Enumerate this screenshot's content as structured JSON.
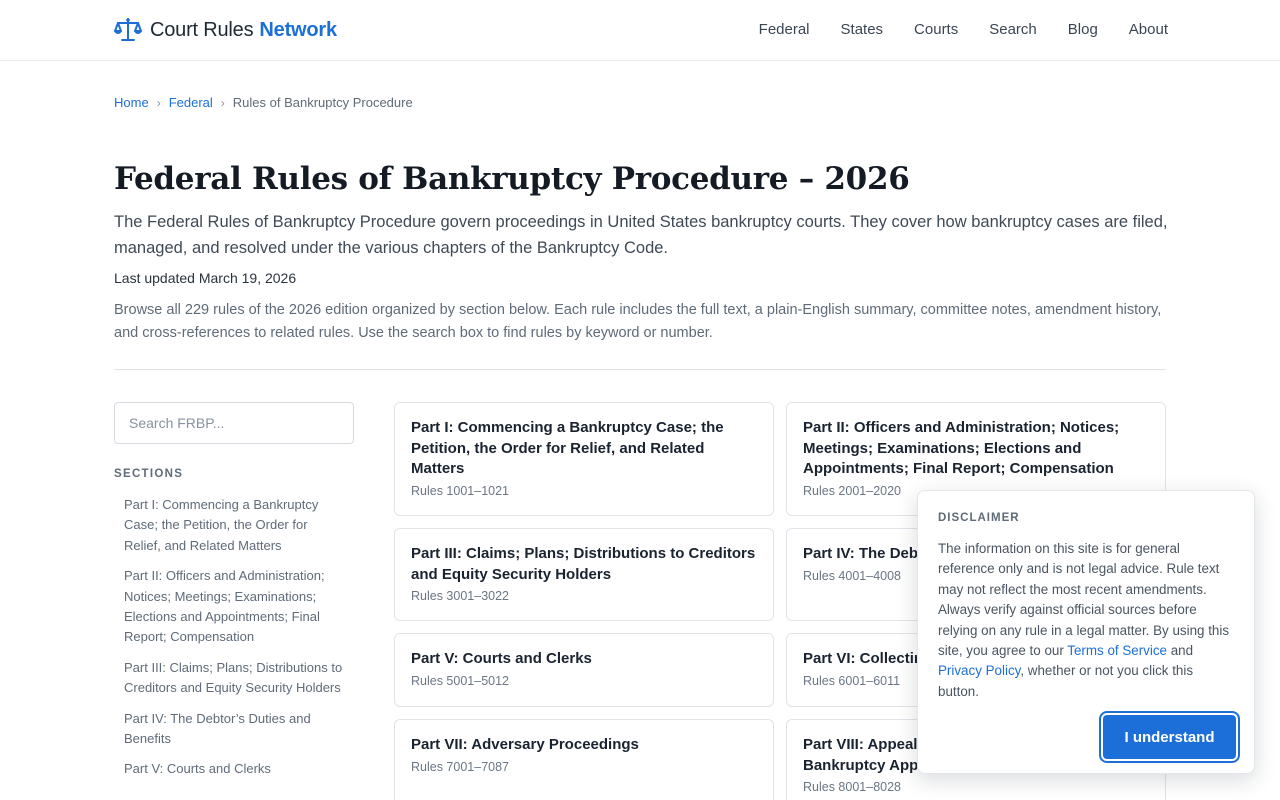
{
  "header": {
    "brand_name": "Court Rules",
    "brand_accent": "Network",
    "brand_icon": "scales-of-justice-icon",
    "nav": [
      "Federal",
      "States",
      "Courts",
      "Search",
      "Blog",
      "About"
    ]
  },
  "breadcrumb": {
    "home": "Home",
    "federal": "Federal",
    "current": "Rules of Bankruptcy Procedure",
    "separator": "›"
  },
  "page": {
    "title": "Federal Rules of Bankruptcy Procedure – 2026",
    "lede": "The Federal Rules of Bankruptcy Procedure govern proceedings in United States bankruptcy courts. They cover how bankruptcy cases are filed, managed, and resolved under the various chapters of the Bankruptcy Code.",
    "updated": "Last updated March 19, 2026",
    "intro": "Browse all 229 rules of the 2026 edition organized by section below. Each rule includes the full text, a plain-English summary, committee notes, amendment history, and cross-references to related rules. Use the search box to find rules by keyword or number."
  },
  "sidebar": {
    "search_placeholder": "Search FRBP...",
    "sections_heading": "SECTIONS",
    "sections": [
      "Part I: Commencing a Bankruptcy Case; the Petition, the Order for Relief, and Related Matters",
      "Part II: Officers and Administration; Notices; Meetings; Examinations; Elections and Appointments; Final Report; Compensation",
      "Part III: Claims; Plans; Distributions to Creditors and Equity Security Holders",
      "Part IV: The Debtor’s Duties and Benefits",
      "Part V: Courts and Clerks"
    ]
  },
  "cards": [
    {
      "title": "Part I: Commencing a Bankruptcy Case; the Petition, the Order for Relief, and Related Matters",
      "rules": "Rules 1001–1021"
    },
    {
      "title": "Part II: Officers and Administration; Notices; Meetings; Examinations; Elections and Appointments; Final Report; Compensation",
      "rules": "Rules 2001–2020"
    },
    {
      "title": "Part III: Claims; Plans; Distributions to Creditors and Equity Security Holders",
      "rules": "Rules 3001–3022"
    },
    {
      "title": "Part IV: The Debt",
      "rules": "Rules 4001–4008"
    },
    {
      "title": "Part V: Courts and Clerks",
      "rules": "Rules 5001–5012"
    },
    {
      "title": "Part VI: Collectin",
      "rules": "Rules 6001–6011"
    },
    {
      "title": "Part VII: Adversary Proceedings",
      "rules": "Rules 7001–7087"
    },
    {
      "title": "Part VIII: Appeal Bankruptcy App",
      "rules": "Rules 8001–8028"
    }
  ],
  "disclaimer": {
    "heading": "DISCLAIMER",
    "text_1": "The information on this site is for general reference only and is not legal advice. Rule text may not reflect the most recent amendments. Always verify against official sources before relying on any rule in a legal matter. By using this site, you agree to our ",
    "terms_link": "Terms of Service",
    "text_2": " and ",
    "privacy_link": "Privacy Policy",
    "text_3": ", whether or not you click this button.",
    "button": "I understand"
  },
  "colors": {
    "accent": "#1c6fd9",
    "text": "#1f2933",
    "muted": "#5f6b78",
    "border": "#e0e4e9"
  }
}
